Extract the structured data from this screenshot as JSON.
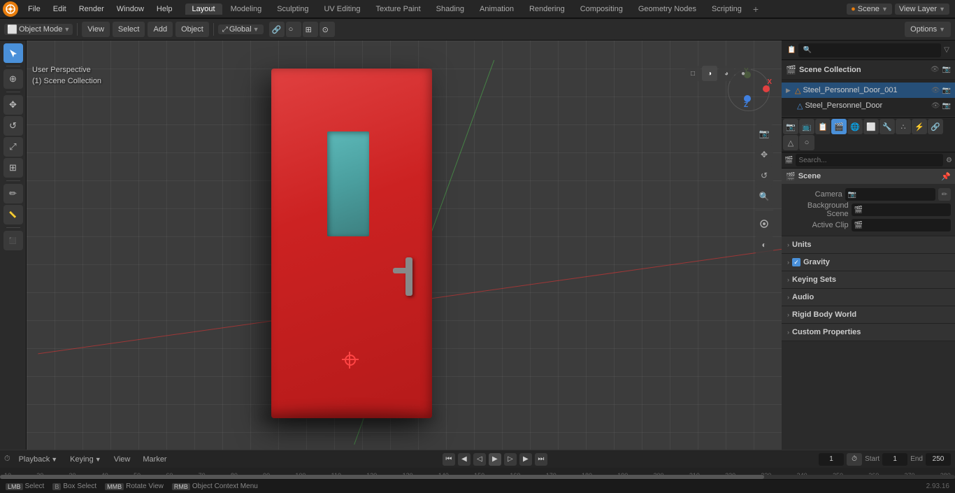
{
  "app": {
    "title": "Blender",
    "version": "2.93.16"
  },
  "top_menu": {
    "items": [
      "File",
      "Edit",
      "Render",
      "Window",
      "Help"
    ]
  },
  "workspace_tabs": {
    "items": [
      "Layout",
      "Modeling",
      "Sculpting",
      "UV Editing",
      "Texture Paint",
      "Shading",
      "Animation",
      "Rendering",
      "Compositing",
      "Geometry Nodes",
      "Scripting"
    ],
    "active": "Layout",
    "scene_label": "Scene",
    "view_layer_label": "View Layer"
  },
  "viewport": {
    "mode": "Object Mode",
    "view_label": "View",
    "select_label": "Select",
    "add_label": "Add",
    "object_label": "Object",
    "transform_global": "Global",
    "options_label": "Options",
    "perspective_label": "User Perspective",
    "collection_label": "(1) Scene Collection"
  },
  "outliner": {
    "title": "Scene Collection",
    "items": [
      {
        "label": "Steel_Personnel_Door_001",
        "type": "mesh",
        "indent": 0,
        "has_arrow": true,
        "selected": true
      },
      {
        "label": "Steel_Personnel_Door",
        "type": "object",
        "indent": 1,
        "has_arrow": false,
        "selected": false
      }
    ]
  },
  "properties": {
    "active_tab": "scene",
    "scene_section": {
      "label": "Scene",
      "camera_label": "Camera",
      "bg_scene_label": "Background Scene",
      "active_clip_label": "Active Clip"
    },
    "sections": [
      {
        "label": "Units",
        "collapsed": true
      },
      {
        "label": "Gravity",
        "collapsed": false,
        "has_checkbox": true,
        "checkbox_checked": true
      },
      {
        "label": "Keying Sets",
        "collapsed": true
      },
      {
        "label": "Audio",
        "collapsed": true
      },
      {
        "label": "Rigid Body World",
        "collapsed": true
      },
      {
        "label": "Custom Properties",
        "collapsed": true
      }
    ]
  },
  "timeline": {
    "playback_label": "Playback",
    "keying_label": "Keying",
    "view_label": "View",
    "marker_label": "Marker",
    "frame_current": "1",
    "frame_start_label": "Start",
    "frame_start": "1",
    "frame_end_label": "End",
    "frame_end": "250",
    "ruler_marks": [
      "10",
      "20",
      "30",
      "40",
      "50",
      "60",
      "70",
      "80",
      "90",
      "100",
      "110",
      "120",
      "130",
      "140",
      "150",
      "160",
      "170",
      "180",
      "190",
      "200",
      "210",
      "220",
      "230",
      "240",
      "250",
      "260",
      "270",
      "280"
    ]
  },
  "status_bar": {
    "select_label": "Select",
    "box_select_label": "Box Select",
    "rotate_label": "Rotate View",
    "object_context_label": "Object Context Menu",
    "version": "2.93.16"
  },
  "icons": {
    "blender_logo": "●",
    "arrow_right": "▶",
    "arrow_down": "▼",
    "cursor": "⊕",
    "move": "✥",
    "rotate": "↺",
    "scale": "⤢",
    "annotate": "✏",
    "measure": "📏",
    "transform": "⊞",
    "camera_icon": "📷",
    "scene_icon": "🎬",
    "filter": "▽",
    "eye": "👁",
    "render": "📷",
    "object_data": "△",
    "material": "○",
    "particle": "∴",
    "physics": "⚡",
    "constraint": "🔗",
    "modifier": "🔧",
    "object_properties": "⬜",
    "scene_properties": "🎬",
    "world": "🌐",
    "output": "📺",
    "view_layer": "📋",
    "check": "✓",
    "chevron_right": "›",
    "chevron_down": "⌄"
  }
}
